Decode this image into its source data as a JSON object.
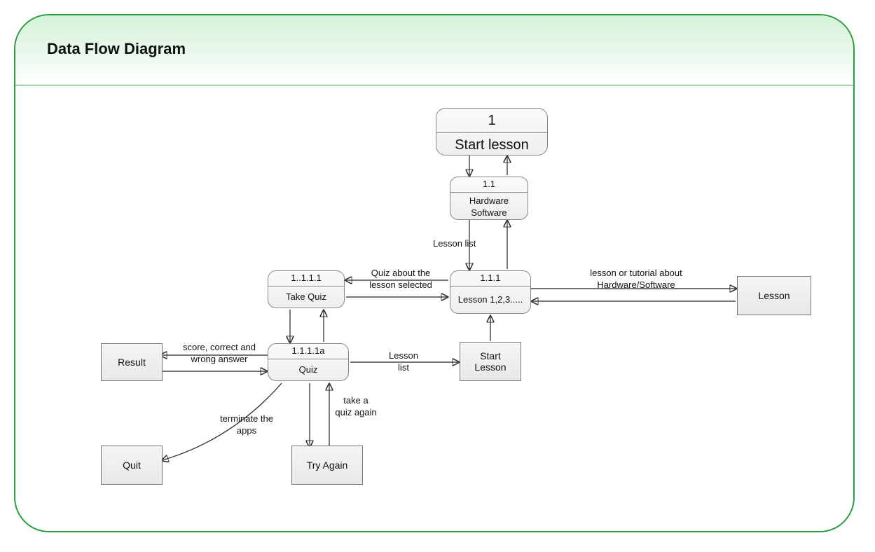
{
  "title": "Data Flow Diagram",
  "processes": {
    "p1": {
      "id": "1",
      "name": "Start lesson"
    },
    "p1_1": {
      "id": "1.1",
      "name": "Hardware Software"
    },
    "p1_1_1": {
      "id": "1.1.1",
      "name": "Lesson 1,2,3....."
    },
    "p1_1_1_1": {
      "id": "1..1.1.1",
      "name": "Take Quiz"
    },
    "p1_1_1_1a": {
      "id": "1.1.1.1a",
      "name": "Quiz"
    }
  },
  "entities": {
    "lesson": "Lesson",
    "start_lesson": "Start Lesson",
    "result": "Result",
    "quit": "Quit",
    "try_again": "Try Again"
  },
  "flows": {
    "lesson_list_top": "Lesson list",
    "quiz_about": "Quiz about the lesson selected",
    "lesson_tutorial": "lesson or tutorial about Hardware/Software",
    "lesson_list_mid": "Lesson list",
    "score": "score, correct and wrong answer",
    "take_quiz_again": "take a quiz again",
    "terminate": "terminate the apps"
  }
}
